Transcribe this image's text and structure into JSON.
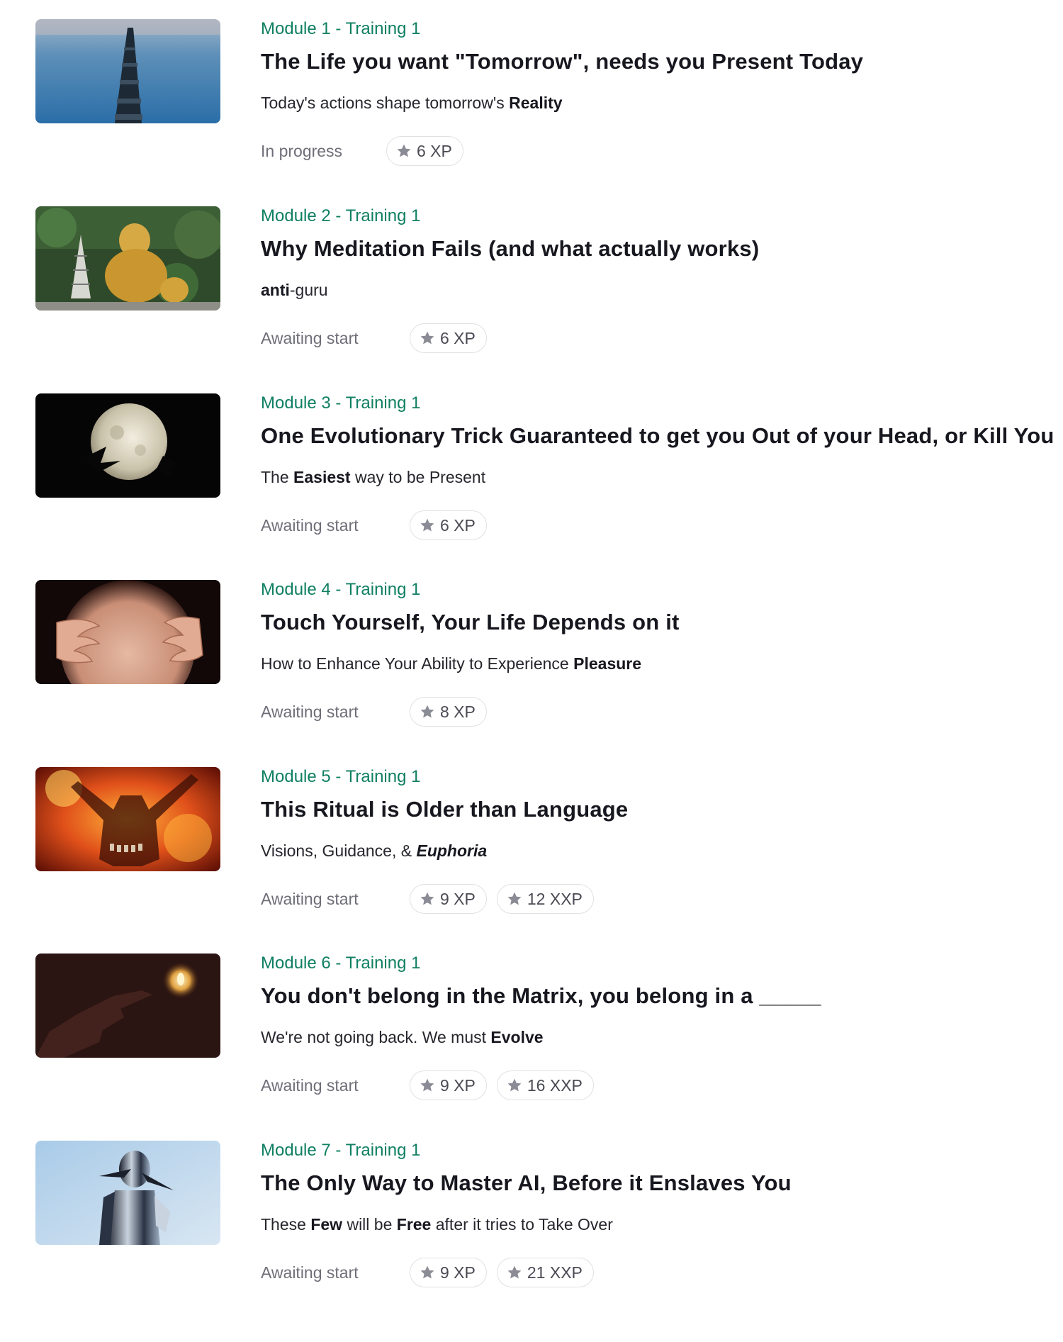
{
  "trainings": [
    {
      "module": "Module 1 - Training 1",
      "title": "The Life you want \"Tomorrow\", needs you Present Today",
      "subtitle": [
        {
          "t": "Today's actions shape tomorrow's "
        },
        {
          "t": "Reality",
          "s": "bold"
        }
      ],
      "status": "In progress",
      "rewards": [
        "6 XP"
      ],
      "thumbnail": "calm-sea-stones-image"
    },
    {
      "module": "Module 2 - Training 1",
      "title": "Why Meditation Fails (and what actually works)",
      "subtitle": [
        {
          "t": "anti",
          "s": "bold"
        },
        {
          "t": "-guru"
        }
      ],
      "status": "Awaiting start",
      "rewards": [
        "6 XP"
      ],
      "thumbnail": "golden-buddha-statue-image"
    },
    {
      "module": "Module 3 - Training 1",
      "title": "One Evolutionary Trick Guaranteed to get you Out of your Head, or Kill You",
      "subtitle": [
        {
          "t": "The "
        },
        {
          "t": "Easiest",
          "s": "bold"
        },
        {
          "t": " way to be Present"
        }
      ],
      "status": "Awaiting start",
      "rewards": [
        "6 XP"
      ],
      "thumbnail": "full-moon-image"
    },
    {
      "module": "Module 4 - Training 1",
      "title": "Touch Yourself, Your Life Depends on it",
      "subtitle": [
        {
          "t": "How to Enhance Your Ability to Experience "
        },
        {
          "t": "Pleasure",
          "s": "bold"
        }
      ],
      "status": "Awaiting start",
      "rewards": [
        "8 XP"
      ],
      "thumbnail": "hands-on-skin-image"
    },
    {
      "module": "Module 5 - Training 1",
      "title": "This Ritual is Older than Language",
      "subtitle": [
        {
          "t": "Visions, Guidance, & "
        },
        {
          "t": "Euphoria",
          "s": "bolditalic"
        }
      ],
      "status": "Awaiting start",
      "rewards": [
        "9 XP",
        "12 XXP"
      ],
      "thumbnail": "fire-ritual-image"
    },
    {
      "module": "Module 6 - Training 1",
      "title": "You don't belong in the Matrix, you belong in a _____",
      "subtitle": [
        {
          "t": "We're not going back. We must "
        },
        {
          "t": "Evolve",
          "s": "bold"
        }
      ],
      "status": "Awaiting start",
      "rewards": [
        "9 XP",
        "16 XXP"
      ],
      "thumbnail": "dark-hand-light-image"
    },
    {
      "module": "Module 7 - Training 1",
      "title": "The Only Way to Master AI, Before it Enslaves You",
      "subtitle": [
        {
          "t": "These "
        },
        {
          "t": "Few",
          "s": "bold"
        },
        {
          "t": " will be "
        },
        {
          "t": "Free",
          "s": "bold"
        },
        {
          "t": " after it tries to Take Over"
        }
      ],
      "status": "Awaiting start",
      "rewards": [
        "9 XP",
        "21 XXP"
      ],
      "thumbnail": "chrome-robot-image"
    }
  ],
  "icons": {
    "reward": "star-icon"
  },
  "colors": {
    "module_label": "#0f7f62",
    "title": "#17171f",
    "status": "#6e6e78",
    "chip_border": "#e1e1e6",
    "star": "#8b8b96"
  }
}
